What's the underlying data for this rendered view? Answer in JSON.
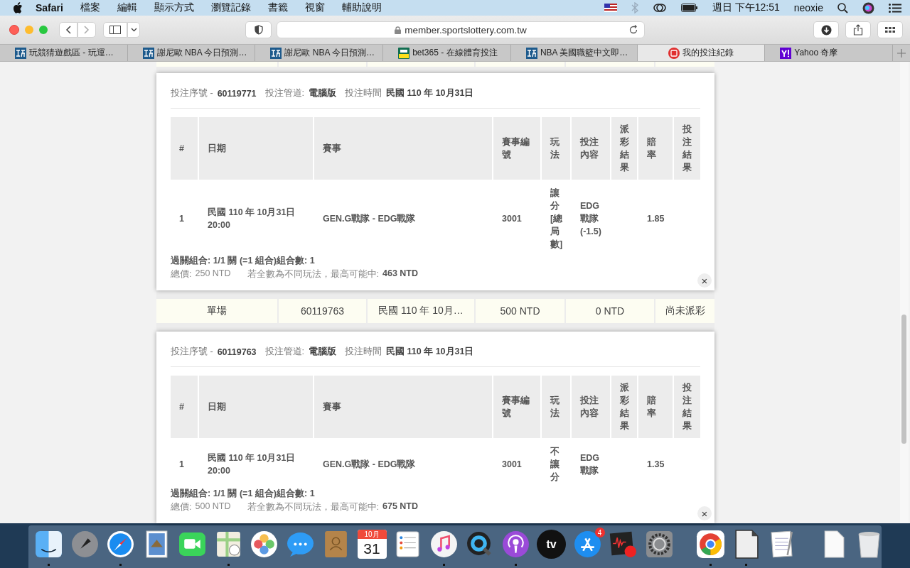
{
  "menubar": {
    "app": "Safari",
    "menus": [
      "檔案",
      "編輯",
      "顯示方式",
      "瀏覽記錄",
      "書籤",
      "視窗",
      "輔助說明"
    ],
    "clock": "週日 下午12:51",
    "user": "neoxie"
  },
  "toolbar": {
    "url": "member.sportslottery.com.tw"
  },
  "tabs": [
    {
      "label": "玩競猜遊戲區 - 玩運…",
      "kind": "wan",
      "selected": false
    },
    {
      "label": "謝尼歐 NBA 今日預測…",
      "kind": "wan",
      "selected": false
    },
    {
      "label": "謝尼歐 NBA 今日預測…",
      "kind": "wan",
      "selected": false
    },
    {
      "label": "bet365 - 在線體育投注",
      "kind": "bet365",
      "selected": false
    },
    {
      "label": "NBA 美國職籃中文即…",
      "kind": "wan",
      "selected": false
    },
    {
      "label": "我的投注紀錄",
      "kind": "lottery",
      "selected": true
    },
    {
      "label": "Yahoo 奇摩",
      "kind": "yahoo",
      "selected": false
    }
  ],
  "records": [
    {
      "kind": "detail",
      "serial_label": "投注序號 -",
      "serial": "60119771",
      "channel_label": "投注管道:",
      "channel": "電腦版",
      "time_label": "投注時間",
      "time": "民國 110 年 10月31日",
      "columns": [
        "#",
        "日期",
        "賽事",
        "賽事編號",
        "玩法",
        "投注內容",
        "派彩結果",
        "賠率",
        "投注結果"
      ],
      "rows": [
        {
          "no": "1",
          "date": "民國 110 年 10月31日 20:00",
          "match": "GEN.G戰隊 - EDG戰隊",
          "match_no": "3001",
          "play": "讓分[總局數]",
          "content": "EDG 戰隊 (-1.5)",
          "odds": "1.85"
        }
      ],
      "combo": "過關組合: 1/1 關 (=1 組合)組合數: 1",
      "total_label": "總價:",
      "total": "250 NTD",
      "max_label": "若全數為不同玩法，最高可能中:",
      "max": "463 NTD",
      "close": "×"
    },
    {
      "kind": "summary",
      "cells": [
        "單場",
        "60119763",
        "民國 110 年 10月…",
        "500 NTD",
        "0 NTD",
        "尚未派彩"
      ]
    },
    {
      "kind": "detail",
      "serial_label": "投注序號 -",
      "serial": "60119763",
      "channel_label": "投注管道:",
      "channel": "電腦版",
      "time_label": "投注時間",
      "time": "民國 110 年 10月31日",
      "columns": [
        "#",
        "日期",
        "賽事",
        "賽事編號",
        "玩法",
        "投注內容",
        "派彩結果",
        "賠率",
        "投注結果"
      ],
      "rows": [
        {
          "no": "1",
          "date": "民國 110 年 10月31日 20:00",
          "match": "GEN.G戰隊 - EDG戰隊",
          "match_no": "3001",
          "play": "不讓分",
          "content": "EDG 戰隊",
          "odds": "1.35"
        }
      ],
      "combo": "過關組合: 1/1 關 (=1 組合)組合數: 1",
      "total_label": "總價:",
      "total": "500 NTD",
      "max_label": "若全數為不同玩法，最高可能中:",
      "max": "675 NTD",
      "close": "×"
    }
  ],
  "dock": [
    {
      "kind": "finder",
      "running": true
    },
    {
      "kind": "launchpad",
      "running": false
    },
    {
      "kind": "safari",
      "running": true
    },
    {
      "kind": "mail",
      "running": false
    },
    {
      "kind": "facetime",
      "running": false
    },
    {
      "kind": "maps",
      "running": true
    },
    {
      "kind": "photos",
      "running": false
    },
    {
      "kind": "messages",
      "running": false
    },
    {
      "kind": "contacts",
      "running": false
    },
    {
      "kind": "calendar",
      "running": false,
      "month": "10月",
      "day": "31"
    },
    {
      "kind": "reminders",
      "running": false
    },
    {
      "kind": "music",
      "running": true
    },
    {
      "kind": "quicktime",
      "running": false
    },
    {
      "kind": "podcasts",
      "running": true
    },
    {
      "kind": "tv",
      "running": false,
      "text": "tv"
    },
    {
      "kind": "appstore",
      "running": false,
      "badge": "4"
    },
    {
      "kind": "recorder",
      "running": false
    },
    {
      "kind": "settings",
      "running": false
    },
    {
      "kind": "separator"
    },
    {
      "kind": "chrome",
      "running": true
    },
    {
      "kind": "document",
      "running": true
    },
    {
      "kind": "textedit",
      "running": false
    },
    {
      "kind": "separator"
    },
    {
      "kind": "file",
      "running": false
    },
    {
      "kind": "trash",
      "running": false
    }
  ]
}
